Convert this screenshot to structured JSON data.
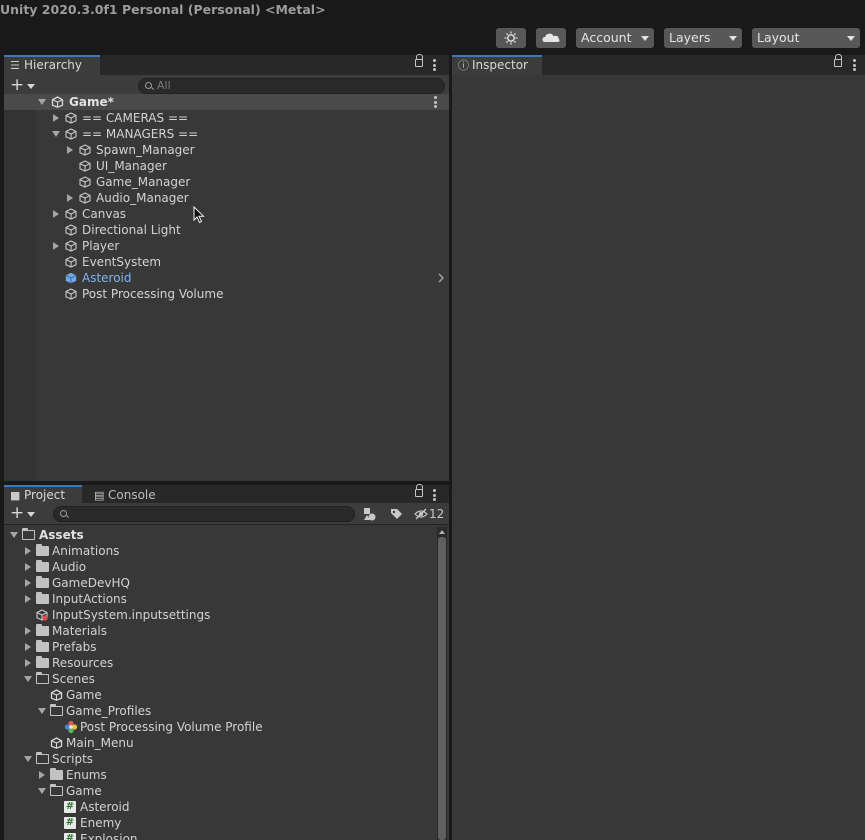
{
  "window": {
    "title": "Unity 2020.3.0f1 Personal (Personal) <Metal>"
  },
  "toolbar": {
    "collab_icon": "collab-icon",
    "cloud_icon": "cloud-icon",
    "account_label": "Account",
    "layers_label": "Layers",
    "layout_label": "Layout"
  },
  "hierarchy": {
    "tab_label": "Hierarchy",
    "search_placeholder": "All",
    "scene_name": "Game*",
    "items": [
      {
        "label": "== CAMERAS =="
      },
      {
        "label": "== MANAGERS =="
      },
      {
        "label": "Spawn_Manager"
      },
      {
        "label": "UI_Manager"
      },
      {
        "label": "Game_Manager"
      },
      {
        "label": "Audio_Manager"
      },
      {
        "label": "Canvas"
      },
      {
        "label": "Directional Light"
      },
      {
        "label": "Player"
      },
      {
        "label": "EventSystem"
      },
      {
        "label": "Asteroid"
      },
      {
        "label": "Post Processing Volume"
      }
    ]
  },
  "inspector": {
    "tab_label": "Inspector"
  },
  "project": {
    "tab_label": "Project",
    "console_tab_label": "Console",
    "hidden_count": "12",
    "items": [
      {
        "label": "Assets"
      },
      {
        "label": "Animations"
      },
      {
        "label": "Audio"
      },
      {
        "label": "GameDevHQ"
      },
      {
        "label": "InputActions"
      },
      {
        "label": "InputSystem.inputsettings"
      },
      {
        "label": "Materials"
      },
      {
        "label": "Prefabs"
      },
      {
        "label": "Resources"
      },
      {
        "label": "Scenes"
      },
      {
        "label": "Game"
      },
      {
        "label": "Game_Profiles"
      },
      {
        "label": "Post Processing Volume Profile"
      },
      {
        "label": "Main_Menu"
      },
      {
        "label": "Scripts"
      },
      {
        "label": "Enums"
      },
      {
        "label": "Game"
      },
      {
        "label": "Asteroid"
      },
      {
        "label": "Enemy"
      },
      {
        "label": "Explosion"
      }
    ]
  },
  "colors": {
    "accent_tab": "#3a79bb",
    "prefab_text": "#7fb3f0",
    "panel_bg": "#383838",
    "chrome_bg": "#191919"
  }
}
